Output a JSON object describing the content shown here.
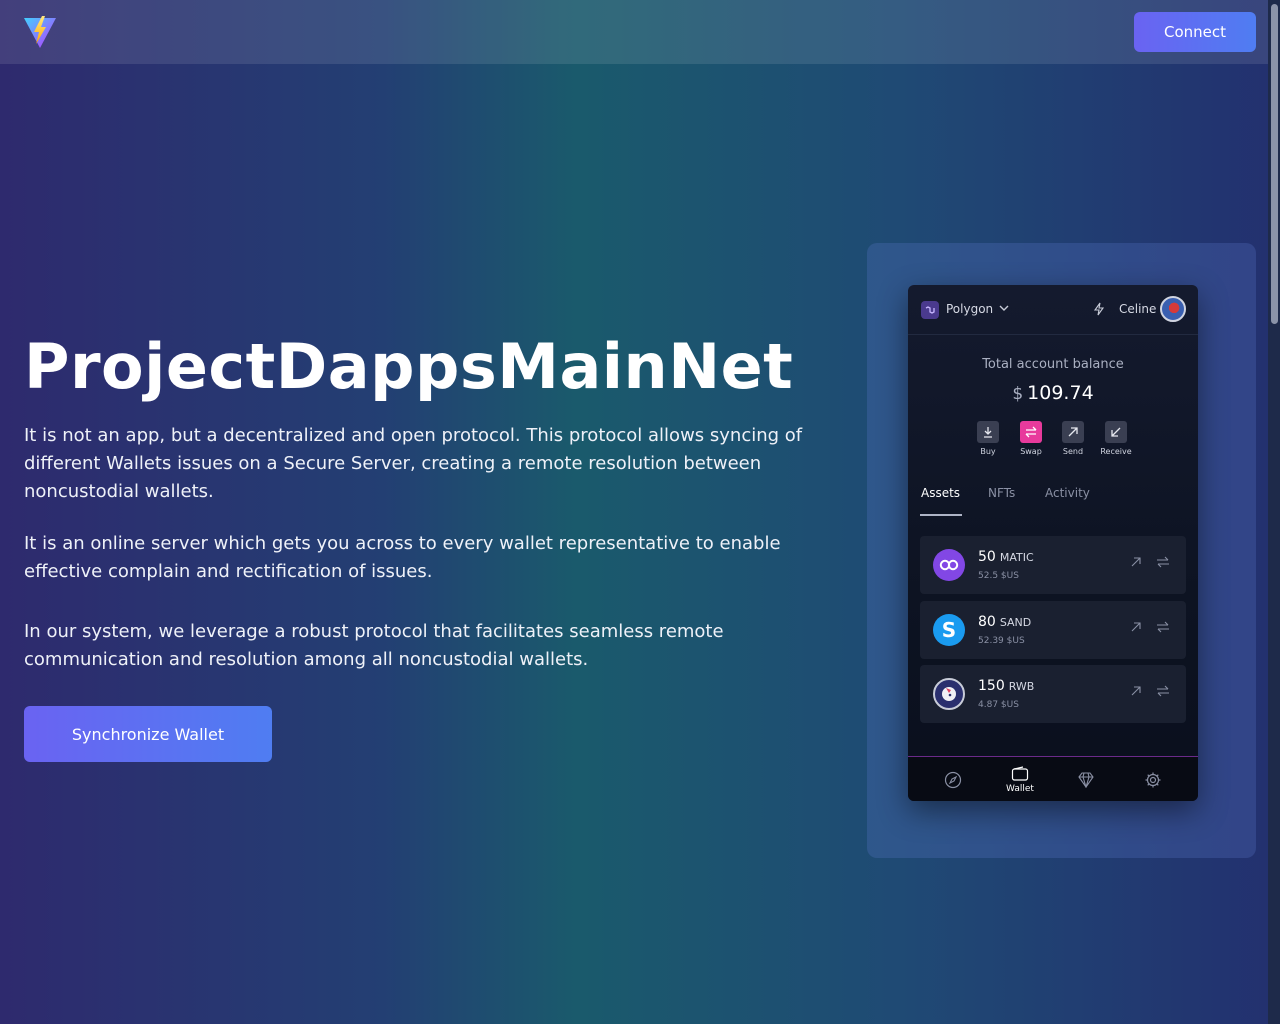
{
  "header": {
    "connect_label": "Connect"
  },
  "hero": {
    "title": "ProjectDappsMainNet",
    "paragraph_1": "It is not an app, but a decentralized and open protocol. This protocol allows syncing of different Wallets issues on a Secure Server, creating a remote resolution between noncustodial wallets.",
    "paragraph_2": "It is an online server which gets you across to every wallet representative to enable effective complain and rectification of issues.",
    "paragraph_3": "In our system, we leverage a robust protocol that facilitates seamless remote communication and resolution among all noncustodial wallets.",
    "sync_button_label": "Synchronize Wallet"
  },
  "wallet": {
    "network": "Polygon",
    "user": "Celine",
    "balance_label": "Total account balance",
    "currency_symbol": "$",
    "balance_value": "109.74",
    "actions": [
      {
        "label": "Buy",
        "icon": "download-icon"
      },
      {
        "label": "Swap",
        "icon": "swap-icon"
      },
      {
        "label": "Send",
        "icon": "arrow-up-right-icon"
      },
      {
        "label": "Receive",
        "icon": "arrow-down-left-icon"
      }
    ],
    "tabs": [
      "Assets",
      "NFTs",
      "Activity"
    ],
    "active_tab": "Assets",
    "assets": [
      {
        "amount": "50",
        "symbol": "MATIC",
        "usd": "52.5 $US",
        "icon_color": "#8247e5"
      },
      {
        "amount": "80",
        "symbol": "SAND",
        "usd": "52.39 $US",
        "icon_color": "#1a9bf0"
      },
      {
        "amount": "150",
        "symbol": "RWB",
        "usd": "4.87 $US",
        "icon_color": "#2a2f6e"
      }
    ],
    "nav": [
      {
        "icon": "compass-icon"
      },
      {
        "icon": "wallet-icon",
        "label": "Wallet"
      },
      {
        "icon": "diamond-icon"
      },
      {
        "icon": "gear-icon"
      }
    ]
  },
  "colors": {
    "accent_button": "#5b6ef2",
    "swap_pink": "#e83a9c",
    "polygon_purple": "#8247e5"
  }
}
